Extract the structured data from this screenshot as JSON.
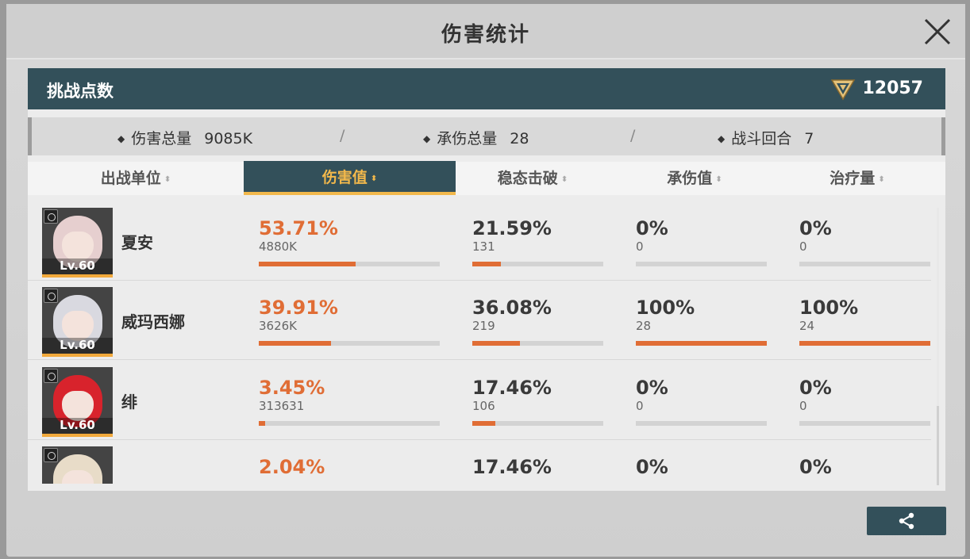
{
  "window": {
    "title": "伤害统计",
    "close_icon": "close-icon"
  },
  "challenge": {
    "label": "挑战点数",
    "value": "12057",
    "icon": "challenge-emblem-icon"
  },
  "stats": [
    {
      "label": "伤害总量",
      "value": "9085K"
    },
    {
      "label": "承伤总量",
      "value": "28"
    },
    {
      "label": "战斗回合",
      "value": "7"
    }
  ],
  "stats_separator": "/",
  "columns": [
    {
      "label": "出战单位",
      "active": false
    },
    {
      "label": "伤害值",
      "active": true
    },
    {
      "label": "稳态击破",
      "active": false
    },
    {
      "label": "承伤值",
      "active": false
    },
    {
      "label": "治疗量",
      "active": false
    }
  ],
  "units": [
    {
      "name": "夏安",
      "level": "Lv.60",
      "hair": "#e6cfcf",
      "damage": {
        "pct": "53.71%",
        "value": "4880K",
        "ratio": 0.5371
      },
      "break": {
        "pct": "21.59%",
        "value": "131",
        "ratio": 0.2159
      },
      "taken": {
        "pct": "0%",
        "value": "0",
        "ratio": 0
      },
      "heal": {
        "pct": "0%",
        "value": "0",
        "ratio": 0
      }
    },
    {
      "name": "威玛西娜",
      "level": "Lv.60",
      "hair": "#d9d9e0",
      "damage": {
        "pct": "39.91%",
        "value": "3626K",
        "ratio": 0.3991
      },
      "break": {
        "pct": "36.08%",
        "value": "219",
        "ratio": 0.3608
      },
      "taken": {
        "pct": "100%",
        "value": "28",
        "ratio": 1.0
      },
      "heal": {
        "pct": "100%",
        "value": "24",
        "ratio": 1.0
      }
    },
    {
      "name": "绯",
      "level": "Lv.60",
      "hair": "#d8232c",
      "damage": {
        "pct": "3.45%",
        "value": "313631",
        "ratio": 0.0345
      },
      "break": {
        "pct": "17.46%",
        "value": "106",
        "ratio": 0.1746
      },
      "taken": {
        "pct": "0%",
        "value": "0",
        "ratio": 0
      },
      "heal": {
        "pct": "0%",
        "value": "0",
        "ratio": 0
      }
    },
    {
      "name": "",
      "level": "",
      "hair": "#e8dcc8",
      "damage": {
        "pct": "2.04%",
        "value": "",
        "ratio": 0.0204
      },
      "break": {
        "pct": "17.46%",
        "value": "",
        "ratio": 0.1746
      },
      "taken": {
        "pct": "0%",
        "value": "",
        "ratio": 0
      },
      "heal": {
        "pct": "0%",
        "value": "",
        "ratio": 0
      }
    }
  ],
  "share": {
    "icon": "share-icon"
  },
  "colors": {
    "accent_dark": "#33505a",
    "highlight": "#f2b84b",
    "damage_orange": "#e06d35"
  }
}
